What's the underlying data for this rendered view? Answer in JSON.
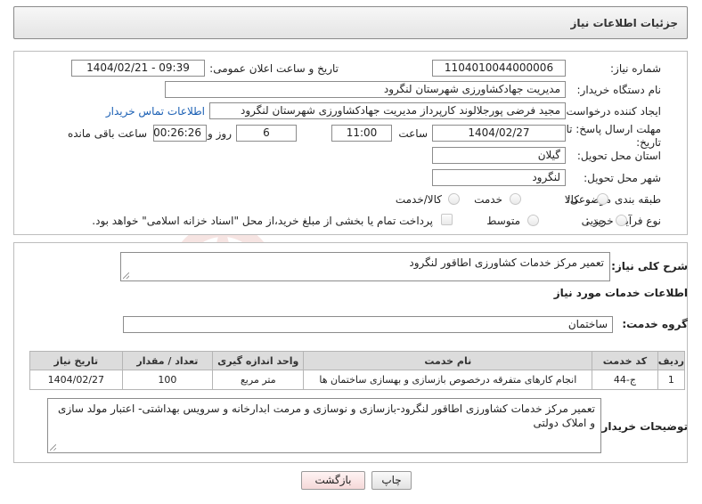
{
  "page": {
    "title": "جزئیات اطلاعات نیاز"
  },
  "fields": {
    "need_number_label": "شماره نیاز:",
    "need_number": "1104010044000006",
    "announce_label": "تاریخ و ساعت اعلان عمومی:",
    "announce_value": "1404/02/21 - 09:39",
    "buyer_org_label": "نام دستگاه خریدار:",
    "buyer_org": "مدیریت جهادکشاورزی شهرستان لنگرود",
    "requester_label": "ایجاد کننده درخواست:",
    "requester": "مجید فرضی پورجلالوند کارپرداز مدیریت جهادکشاورزی شهرستان لنگرود",
    "contact_link": "اطلاعات تماس خریدار",
    "deadline_label": "مهلت ارسال پاسخ: تا تاریخ:",
    "deadline_date": "1404/02/27",
    "time_label": "ساعت",
    "deadline_time": "11:00",
    "days_value": "6",
    "days_label": "روز و",
    "remaining_time": "00:26:26",
    "remaining_label": "ساعت باقی مانده",
    "province_label": "استان محل تحویل:",
    "province": "گیلان",
    "city_label": "شهر محل تحویل:",
    "city": "لنگرود",
    "category_label": "طبقه بندی موضوعی:",
    "category_options": [
      "کالا",
      "خدمت",
      "کالا/خدمت"
    ],
    "process_label": "نوع فرآیند خرید :",
    "process_options": [
      "جزیی",
      "متوسط"
    ],
    "payment_note": "پرداخت تمام یا بخشی از مبلغ خرید،از محل \"اسناد خزانه اسلامی\" خواهد بود."
  },
  "summary": {
    "label": "شرح کلی نیاز:",
    "value": "تعمیر مرکز خدمات کشاورزی اطاقور لنگرود"
  },
  "services": {
    "section_title": "اطلاعات خدمات مورد نیاز",
    "group_label": "گروه خدمت:",
    "group_value": "ساختمان",
    "columns": [
      "ردیف",
      "کد خدمت",
      "نام خدمت",
      "واحد اندازه گیری",
      "تعداد / مقدار",
      "تاریخ نیاز"
    ],
    "rows": [
      [
        "1",
        "ج-44",
        "انجام کارهای متفرقه درخصوص بازسازی و بهسازی ساختمان ها",
        "متر مربع",
        "100",
        "1404/02/27"
      ]
    ]
  },
  "buyer_notes": {
    "label": "توضیحات خریدار:",
    "value": "تعمیر مرکز خدمات کشاورزی اطاقور لنگرود-بازسازی و نوسازی و مرمت ابدارخانه و سرویس بهداشتی- اعتبار مولد سازی و املاک دولتی"
  },
  "buttons": {
    "print": "چاپ",
    "back": "بازگشت"
  },
  "watermark": {
    "text": "AriaTender.neT",
    "color": "#c0392b"
  }
}
